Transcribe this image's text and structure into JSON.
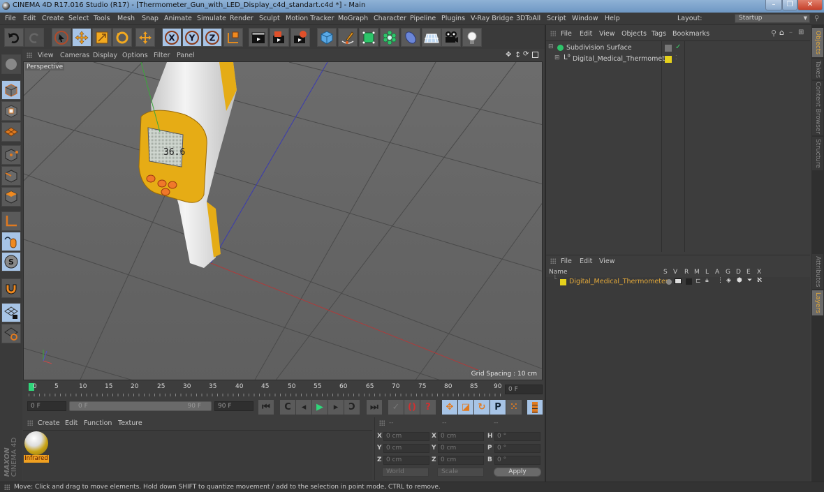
{
  "window": {
    "title": "CINEMA 4D R17.016 Studio (R17) - [Thermometer_Gun_with_LED_Display_c4d_standart.c4d *] - Main",
    "controls": {
      "minimize": "–",
      "maximize": "❐",
      "close": "✕"
    }
  },
  "menubar": {
    "items": [
      "File",
      "Edit",
      "Create",
      "Select",
      "Tools",
      "Mesh",
      "Snap",
      "Animate",
      "Simulate",
      "Render",
      "Sculpt",
      "Motion Tracker",
      "MoGraph",
      "Character",
      "Pipeline",
      "Plugins",
      "V-Ray Bridge",
      "3DToAll",
      "Script",
      "Window",
      "Help"
    ],
    "layout_label": "Layout:",
    "layout_value": "Startup"
  },
  "toolbar": {
    "icons": [
      "undo-icon",
      "redo-icon",
      "live-selection-icon",
      "move-icon",
      "scale-icon",
      "rotate-icon",
      "recent-tool-icon",
      "x-axis-icon",
      "y-axis-icon",
      "z-axis-icon",
      "coordinate-system-icon",
      "render-view-icon",
      "render-picture-viewer-icon",
      "edit-render-settings-icon",
      "cube-icon",
      "pen-spline-icon",
      "subdivision-surface-icon",
      "cloner-icon",
      "deformer-icon",
      "floor-icon",
      "camera-icon",
      "light-icon"
    ],
    "axis_labels": {
      "x": "X",
      "y": "Y",
      "z": "Z"
    }
  },
  "viewport": {
    "menu": [
      "View",
      "Cameras",
      "Display",
      "Options",
      "Filter",
      "Panel"
    ],
    "camera_label": "Perspective",
    "grid_spacing": "Grid Spacing : 10 cm",
    "nav_icons": [
      "pan-icon",
      "dolly-icon",
      "orbit-icon",
      "maximize-view-icon"
    ],
    "display_reading": "36.6"
  },
  "left_toolbar": {
    "icons": [
      "make-editable-icon",
      "texture-mode-icon",
      "workplane-icon",
      "points-mode-icon",
      "edges-mode-icon",
      "polygons-mode-icon",
      "enable-axis-icon",
      "tweak-mode-icon",
      "solo-icon",
      "snapping-icon",
      "lock-workplane-icon",
      "planar-workplane-icon"
    ]
  },
  "timeline": {
    "ticks": [
      "0",
      "5",
      "10",
      "15",
      "20",
      "25",
      "30",
      "35",
      "40",
      "45",
      "50",
      "55",
      "60",
      "65",
      "70",
      "75",
      "80",
      "85",
      "90"
    ],
    "current_frame": "0 F",
    "start_field": "0 F",
    "range_start": "0 F",
    "range_end": "90 F",
    "end_field": "90 F"
  },
  "transport": {
    "buttons": [
      {
        "name": "go-to-start-button",
        "glyph": "⏮"
      },
      {
        "name": "previous-key-button",
        "glyph": "C"
      },
      {
        "name": "previous-frame-button",
        "glyph": "◂"
      },
      {
        "name": "play-button",
        "glyph": "▶"
      },
      {
        "name": "next-frame-button",
        "glyph": "▸"
      },
      {
        "name": "next-key-button",
        "glyph": "Ɔ"
      },
      {
        "name": "go-to-end-button",
        "glyph": "⏭"
      }
    ],
    "record_buttons": [
      {
        "name": "record-active-objects-button",
        "glyph": "✓"
      },
      {
        "name": "autokeying-button",
        "glyph": "()"
      },
      {
        "name": "keyframe-selection-button",
        "glyph": "?"
      }
    ],
    "key_buttons": [
      {
        "name": "record-position-button",
        "glyph": "✥"
      },
      {
        "name": "record-scale-button",
        "glyph": "◪"
      },
      {
        "name": "record-rotation-button",
        "glyph": "↻"
      },
      {
        "name": "record-parameter-button",
        "glyph": "P"
      },
      {
        "name": "record-pla-button",
        "glyph": "⁙"
      }
    ]
  },
  "material_manager": {
    "menu": [
      "Create",
      "Edit",
      "Function",
      "Texture"
    ],
    "materials": [
      {
        "name": "Infrared"
      }
    ],
    "brand_top": "MAXON",
    "brand_bottom": "CINEMA 4D"
  },
  "coordinates": {
    "headers": [
      "--",
      "--",
      "--"
    ],
    "rows": [
      {
        "l1": "X",
        "v1": "0 cm",
        "l2": "X",
        "v2": "0 cm",
        "l3": "H",
        "v3": "0 °"
      },
      {
        "l1": "Y",
        "v1": "0 cm",
        "l2": "Y",
        "v2": "0 cm",
        "l3": "P",
        "v3": "0 °"
      },
      {
        "l1": "Z",
        "v1": "0 cm",
        "l2": "Z",
        "v2": "0 cm",
        "l3": "B",
        "v3": "0 °"
      }
    ],
    "space_select": "World",
    "mode_select": "Scale",
    "apply_label": "Apply"
  },
  "object_manager": {
    "menu": [
      "File",
      "Edit",
      "View",
      "Objects",
      "Tags",
      "Bookmarks"
    ],
    "objects": [
      {
        "name": "Subdivision Surface",
        "depth": 0,
        "icon": "subdivision-surface-icon"
      },
      {
        "name": "Digital_Medical_Thermometer",
        "depth": 1,
        "icon": "null-object-icon",
        "layer_color": "#e5d11c"
      }
    ]
  },
  "layer_manager": {
    "menu": [
      "File",
      "Edit",
      "View"
    ],
    "columns": [
      "Name",
      "S",
      "V",
      "R",
      "M",
      "L",
      "A",
      "G",
      "D",
      "E",
      "X"
    ],
    "layers": [
      {
        "name": "Digital_Medical_Thermometer",
        "color": "#e5d11c"
      }
    ]
  },
  "right_tabs": [
    {
      "label": "Objects",
      "active": true
    },
    {
      "label": "Takes",
      "active": false
    },
    {
      "label": "Content Browser",
      "active": false
    },
    {
      "label": "Structure",
      "active": false
    },
    {
      "label": "Attributes",
      "active": false
    },
    {
      "label": "Layers",
      "active": true
    }
  ],
  "statusbar": {
    "text": "Move: Click and drag to move elements. Hold down SHIFT to quantize movement / add to the selection in point mode, CTRL to remove."
  },
  "colors": {
    "accent_orange": "#e3a93a",
    "selected_blue": "#a7c4e6",
    "layer_yellow": "#e5d11c"
  }
}
